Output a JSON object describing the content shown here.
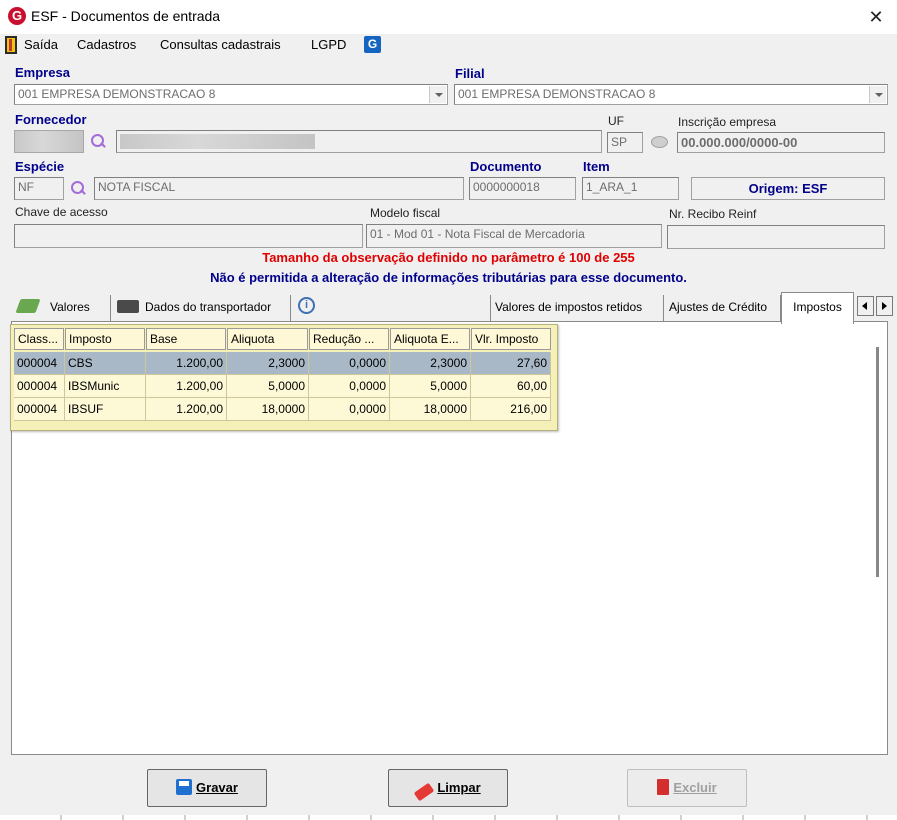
{
  "window": {
    "title": "ESF - Documentos de entrada",
    "close": "✕",
    "logo": "G"
  },
  "menu": [
    {
      "label": "Saída"
    },
    {
      "label": "Cadastros"
    },
    {
      "label": "Consultas cadastrais"
    },
    {
      "label": "LGPD"
    }
  ],
  "menu_g_icon": "G",
  "labels": {
    "empresa": "Empresa",
    "filial": "Filial",
    "fornecedor": "Fornecedor",
    "uf": "UF",
    "inscricao": "Inscrição empresa",
    "especie": "Espécie",
    "documento": "Documento",
    "item": "Item",
    "chave": "Chave de acesso",
    "modelo": "Modelo fiscal",
    "recibo": "Nr. Recibo Reinf"
  },
  "fields": {
    "empresa": "001 EMPRESA DEMONSTRACAO 8",
    "filial": "001 EMPRESA DEMONSTRACAO 8",
    "uf": "SP",
    "inscricao": "00.000.000/0000-00",
    "especie_code": "NF",
    "especie_desc": "NOTA FISCAL",
    "documento": "0000000018",
    "item": "1_ARA_1",
    "origem": "Origem: ESF",
    "chave": "",
    "modelo": "01 - Mod 01 - Nota Fiscal de Mercadoria",
    "recibo": ""
  },
  "messages": {
    "warning": "Tamanho da observação definido no parâmetro é 100 de 255",
    "info": "Não é permitida a alteração de informações tributárias para esse documento."
  },
  "tabs": [
    {
      "label": "Valores",
      "icon": "money-icon"
    },
    {
      "label": "Dados do transportador",
      "icon": "truck-icon"
    },
    {
      "label": "Valores de impostos retidos"
    },
    {
      "label": "Ajustes de Crédito"
    },
    {
      "label": "Impostos",
      "active": true
    }
  ],
  "grid": {
    "columns": [
      "Class...",
      "Imposto",
      "Base",
      "Aliquota",
      "Redução ...",
      "Aliquota E...",
      "Vlr. Imposto"
    ],
    "rows": [
      [
        "000004",
        "CBS",
        "1.200,00",
        "2,3000",
        "0,0000",
        "2,3000",
        "27,60"
      ],
      [
        "000004",
        "IBSMunic",
        "1.200,00",
        "5,0000",
        "0,0000",
        "5,0000",
        "60,00"
      ],
      [
        "000004",
        "IBSUF",
        "1.200,00",
        "18,0000",
        "0,0000",
        "18,0000",
        "216,00"
      ]
    ],
    "selected_row": 0
  },
  "buttons": {
    "save": "Gravar",
    "clear": "Limpar",
    "delete": "Excluir"
  }
}
